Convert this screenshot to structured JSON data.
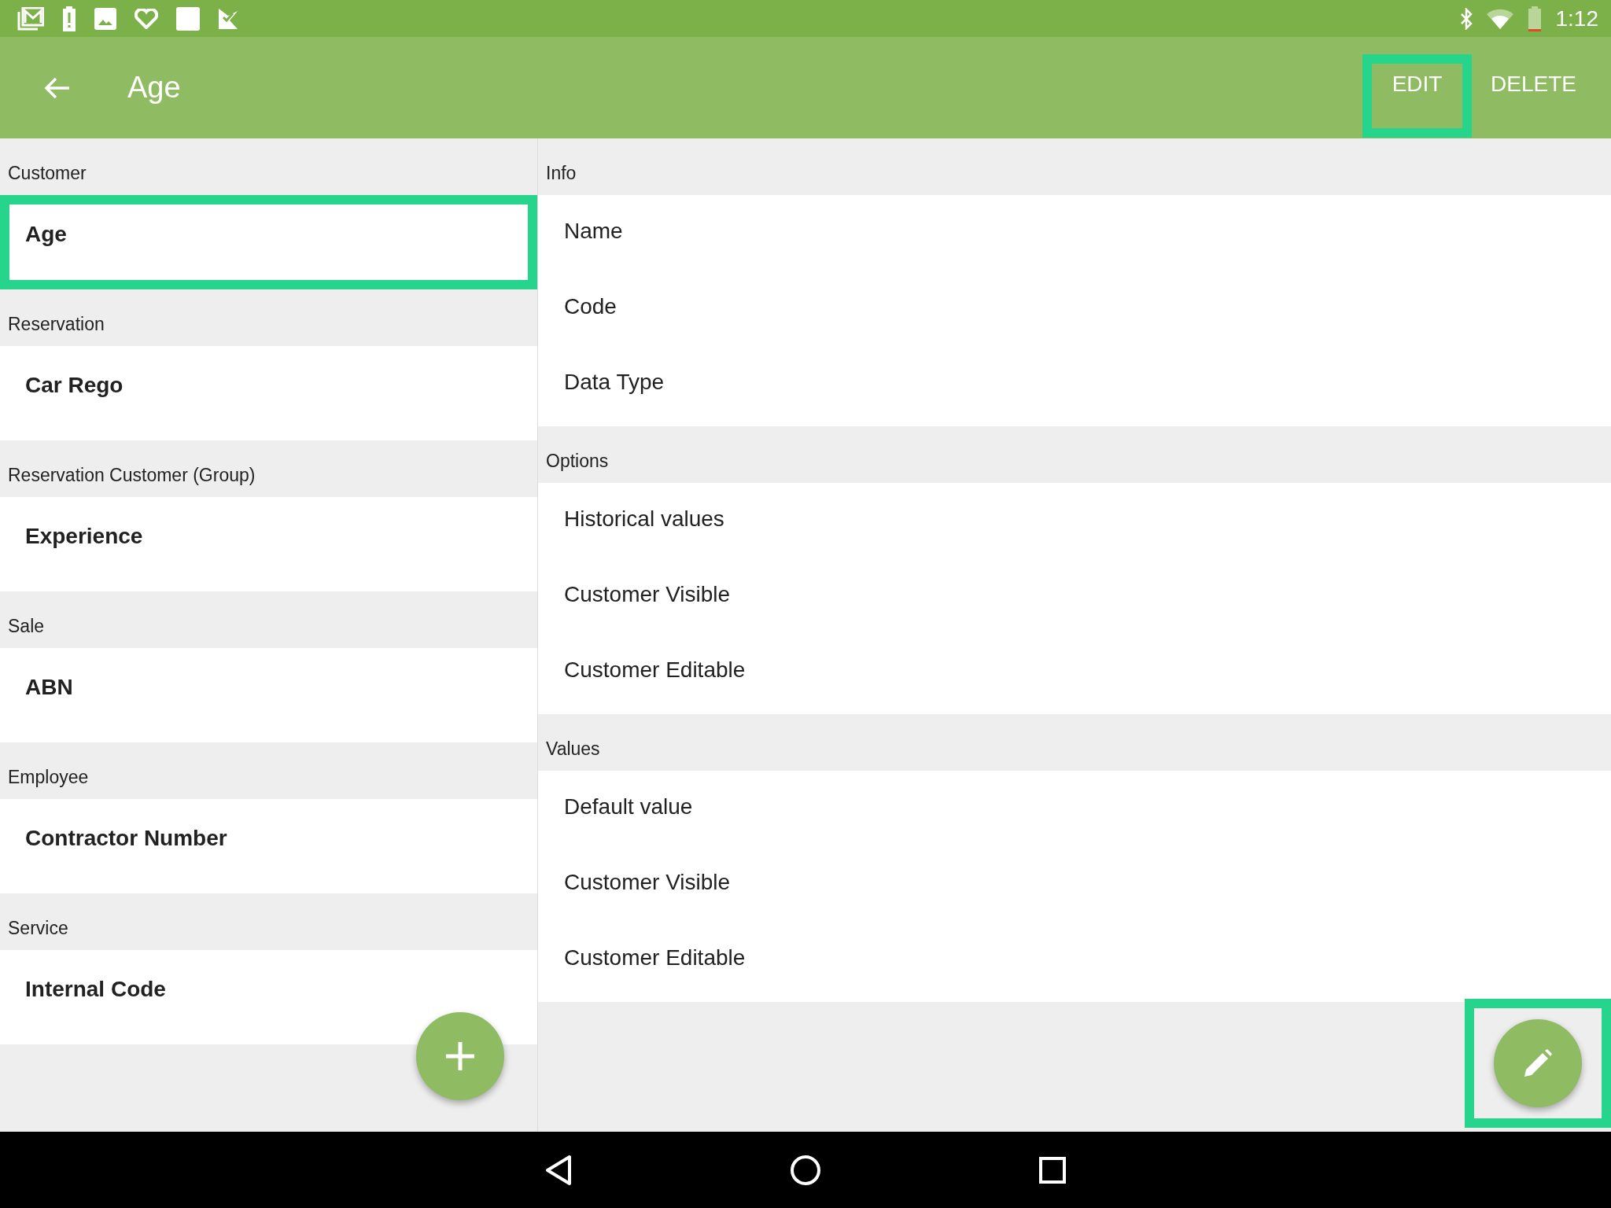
{
  "status_bar": {
    "time": "1:12"
  },
  "app_bar": {
    "title": "Age",
    "actions": [
      {
        "label": "EDIT",
        "highlighted": true
      },
      {
        "label": "DELETE",
        "highlighted": false
      }
    ]
  },
  "field_groups": [
    {
      "heading": "Customer",
      "items": [
        {
          "label": "Age",
          "highlighted": true
        }
      ]
    },
    {
      "heading": "Reservation",
      "items": [
        {
          "label": "Car Rego",
          "highlighted": false
        }
      ]
    },
    {
      "heading": "Reservation Customer (Group)",
      "items": [
        {
          "label": "Experience",
          "highlighted": false
        }
      ]
    },
    {
      "heading": "Sale",
      "items": [
        {
          "label": "ABN",
          "highlighted": false
        }
      ]
    },
    {
      "heading": "Employee",
      "items": [
        {
          "label": "Contractor Number",
          "highlighted": false
        }
      ]
    },
    {
      "heading": "Service",
      "items": [
        {
          "label": "Internal Code",
          "highlighted": false
        }
      ]
    }
  ],
  "details": [
    {
      "heading": "Info",
      "rows": [
        "Name",
        "Code",
        "Data Type"
      ]
    },
    {
      "heading": "Options",
      "rows": [
        "Historical values",
        "Customer Visible",
        "Customer Editable"
      ]
    },
    {
      "heading": "Values",
      "rows": [
        "Default value",
        "Customer Visible",
        "Customer Editable"
      ]
    }
  ],
  "fabs": [
    {
      "kind": "add",
      "highlighted": false
    },
    {
      "kind": "edit",
      "highlighted": true
    }
  ]
}
